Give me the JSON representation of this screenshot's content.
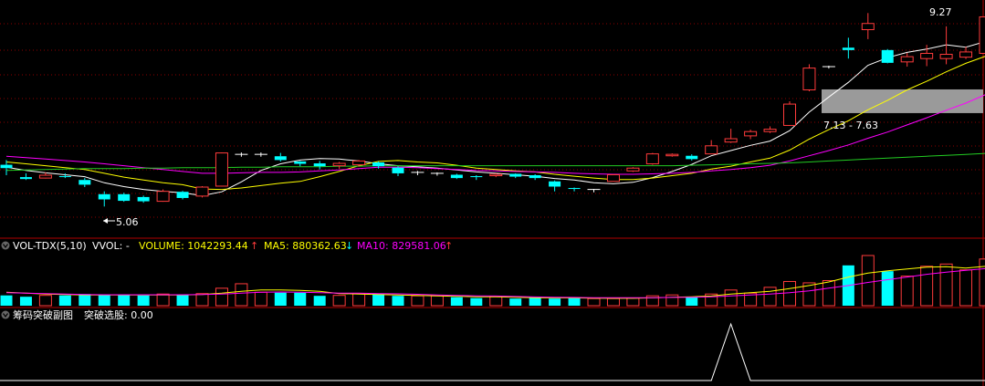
{
  "chart_data": [
    {
      "type": "candlestick",
      "price_labels": {
        "high": "9.27",
        "low": "5.06",
        "range": "7.13 - 7.63"
      },
      "colors": {
        "up": "#ff3b3b",
        "down": "#00ffff",
        "flat": "#ffffff",
        "ma_white": "#ffffff",
        "ma_yellow": "#ffff00",
        "ma_magenta": "#ff00ff",
        "ma_green": "#22cc22",
        "grid": "#8b0000",
        "band": "#9a9a9a"
      },
      "candles": [
        [
          6.04,
          6.14,
          5.82,
          5.97
        ],
        [
          5.78,
          5.86,
          5.72,
          5.74
        ],
        [
          5.76,
          5.88,
          5.75,
          5.82
        ],
        [
          5.8,
          5.86,
          5.76,
          5.79
        ],
        [
          5.72,
          5.76,
          5.57,
          5.62
        ],
        [
          5.42,
          5.48,
          5.16,
          5.31
        ],
        [
          5.42,
          5.45,
          5.26,
          5.28
        ],
        [
          5.36,
          5.39,
          5.24,
          5.27
        ],
        [
          5.27,
          5.52,
          5.26,
          5.48
        ],
        [
          5.47,
          5.49,
          5.31,
          5.34
        ],
        [
          5.38,
          5.59,
          5.35,
          5.57
        ],
        [
          5.59,
          6.3,
          5.58,
          6.29
        ],
        [
          6.26,
          6.3,
          6.21,
          6.26
        ],
        [
          6.26,
          6.3,
          6.21,
          6.26
        ],
        [
          6.22,
          6.29,
          6.11,
          6.14
        ],
        [
          6.11,
          6.12,
          6.01,
          6.06
        ],
        [
          6.07,
          6.12,
          5.94,
          6.01
        ],
        [
          6.02,
          6.1,
          5.95,
          6.07
        ],
        [
          6.04,
          6.14,
          6.0,
          6.12
        ],
        [
          6.09,
          6.11,
          5.96,
          6.01
        ],
        [
          5.98,
          6.01,
          5.8,
          5.86
        ],
        [
          5.88,
          5.91,
          5.82,
          5.88
        ],
        [
          5.86,
          5.88,
          5.81,
          5.86
        ],
        [
          5.83,
          5.85,
          5.74,
          5.76
        ],
        [
          5.8,
          5.82,
          5.72,
          5.78
        ],
        [
          5.81,
          5.86,
          5.78,
          5.84
        ],
        [
          5.85,
          5.86,
          5.76,
          5.79
        ],
        [
          5.82,
          5.84,
          5.72,
          5.76
        ],
        [
          5.69,
          5.71,
          5.48,
          5.58
        ],
        [
          5.55,
          5.56,
          5.48,
          5.54
        ],
        [
          5.52,
          5.53,
          5.46,
          5.52
        ],
        [
          5.69,
          5.84,
          5.69,
          5.83
        ],
        [
          5.91,
          5.99,
          5.89,
          5.97
        ],
        [
          6.06,
          6.29,
          6.04,
          6.27
        ],
        [
          6.23,
          6.28,
          6.21,
          6.26
        ],
        [
          6.23,
          6.26,
          6.13,
          6.16
        ],
        [
          6.27,
          6.56,
          6.27,
          6.44
        ],
        [
          6.52,
          6.8,
          6.5,
          6.59
        ],
        [
          6.65,
          6.78,
          6.58,
          6.74
        ],
        [
          6.74,
          6.85,
          6.71,
          6.79
        ],
        [
          6.87,
          7.38,
          6.86,
          7.32
        ],
        [
          7.62,
          8.16,
          7.59,
          8.08
        ],
        [
          8.11,
          8.13,
          8.07,
          8.11
        ],
        [
          8.51,
          8.72,
          8.28,
          8.46
        ],
        [
          8.89,
          9.24,
          8.69,
          9.02
        ],
        [
          8.46,
          8.48,
          8.18,
          8.19
        ],
        [
          8.21,
          8.4,
          8.11,
          8.32
        ],
        [
          8.28,
          8.57,
          8.12,
          8.39
        ],
        [
          8.28,
          8.96,
          8.16,
          8.37
        ],
        [
          8.31,
          8.53,
          8.27,
          8.42
        ],
        [
          8.39,
          9.27,
          8.34,
          9.16
        ]
      ],
      "moving_averages": {
        "white": [
          5.99,
          5.92,
          5.87,
          5.83,
          5.79,
          5.66,
          5.58,
          5.52,
          5.48,
          5.45,
          5.39,
          5.47,
          5.68,
          5.92,
          6.06,
          6.14,
          6.17,
          6.16,
          6.12,
          6.06,
          6.02,
          6.0,
          5.97,
          5.93,
          5.89,
          5.86,
          5.83,
          5.8,
          5.75,
          5.72,
          5.66,
          5.64,
          5.67,
          5.77,
          5.9,
          6.05,
          6.23,
          6.34,
          6.45,
          6.54,
          6.76,
          7.15,
          7.47,
          7.78,
          8.14,
          8.3,
          8.41,
          8.48,
          8.57,
          8.52,
          8.64
        ],
        "yellow": [
          6.1,
          6.06,
          6.02,
          5.98,
          5.94,
          5.86,
          5.78,
          5.72,
          5.66,
          5.62,
          5.53,
          5.52,
          5.55,
          5.6,
          5.65,
          5.69,
          5.79,
          5.9,
          6.02,
          6.11,
          6.13,
          6.1,
          6.08,
          6.03,
          5.97,
          5.94,
          5.91,
          5.89,
          5.84,
          5.8,
          5.76,
          5.73,
          5.73,
          5.76,
          5.81,
          5.86,
          5.95,
          6.01,
          6.1,
          6.18,
          6.35,
          6.58,
          6.78,
          6.97,
          7.2,
          7.4,
          7.62,
          7.8,
          8.0,
          8.18,
          8.33
        ],
        "magenta": [
          6.22,
          6.19,
          6.16,
          6.13,
          6.1,
          6.06,
          6.02,
          5.98,
          5.94,
          5.9,
          5.86,
          5.86,
          5.87,
          5.88,
          5.88,
          5.89,
          5.91,
          5.93,
          5.96,
          5.99,
          5.99,
          5.98,
          5.96,
          5.94,
          5.92,
          5.91,
          5.9,
          5.89,
          5.88,
          5.86,
          5.85,
          5.84,
          5.84,
          5.85,
          5.86,
          5.88,
          5.91,
          5.94,
          5.98,
          6.03,
          6.12,
          6.23,
          6.34,
          6.46,
          6.6,
          6.73,
          6.88,
          7.03,
          7.19,
          7.34,
          7.52
        ],
        "green": [
          5.92,
          5.93,
          5.94,
          5.95,
          5.96,
          5.96,
          5.96,
          5.97,
          5.97,
          5.98,
          5.98,
          5.98,
          5.99,
          5.99,
          6.0,
          6.0,
          6.0,
          6.01,
          6.01,
          6.02,
          6.02,
          6.02,
          6.02,
          6.02,
          6.02,
          6.02,
          6.02,
          6.02,
          6.02,
          6.02,
          6.02,
          6.02,
          6.02,
          6.02,
          6.02,
          6.03,
          6.04,
          6.05,
          6.06,
          6.07,
          6.08,
          6.1,
          6.12,
          6.14,
          6.16,
          6.18,
          6.2,
          6.22,
          6.24,
          6.26,
          6.28
        ]
      },
      "band": [
        7.13,
        7.63
      ]
    },
    {
      "type": "bar",
      "indicator": "VOL-TDX(5,10)",
      "labels": {
        "name": "VOL-TDX(5,10)",
        "vol": "VVOL: -",
        "volume": "VOLUME: 1042293.44",
        "ma5": "MA5: 880362.63",
        "ma10": "MA10: 829581.06"
      },
      "colors": {
        "label": "#ffffff",
        "volume": "#ffff00",
        "ma5": "#ffff00",
        "ma10": "#ff00ff",
        "up_arrow": "#ff3b3b",
        "down_arrow": "#00ffff"
      },
      "arrows": [
        "↑",
        "↑",
        "↓",
        "↑"
      ],
      "volumes": [
        230000,
        200000,
        230000,
        230000,
        260000,
        240000,
        240000,
        230000,
        260000,
        240000,
        270000,
        390000,
        490000,
        300000,
        290000,
        290000,
        220000,
        230000,
        270000,
        260000,
        220000,
        220000,
        220000,
        190000,
        170000,
        200000,
        160000,
        180000,
        160000,
        170000,
        160000,
        160000,
        170000,
        220000,
        240000,
        190000,
        260000,
        350000,
        280000,
        410000,
        540000,
        510000,
        560000,
        900000,
        1120000,
        770000,
        660000,
        880000,
        930000,
        800000,
        1042293
      ],
      "ma5_values": [
        300000,
        280000,
        260000,
        250000,
        240000,
        240000,
        240000,
        240000,
        240000,
        240000,
        250000,
        280000,
        320000,
        350000,
        350000,
        340000,
        320000,
        270000,
        260000,
        250000,
        240000,
        230000,
        220000,
        210000,
        200000,
        200000,
        190000,
        180000,
        175000,
        175000,
        170000,
        165000,
        165000,
        175000,
        190000,
        200000,
        215000,
        260000,
        290000,
        320000,
        380000,
        450000,
        530000,
        640000,
        730000,
        780000,
        820000,
        860000,
        870000,
        840000,
        880363
      ],
      "ma10_values": [
        290000,
        280000,
        270000,
        260000,
        250000,
        245000,
        245000,
        245000,
        245000,
        245000,
        250000,
        260000,
        280000,
        300000,
        305000,
        300000,
        290000,
        280000,
        280000,
        270000,
        265000,
        255000,
        240000,
        230000,
        220000,
        215000,
        205000,
        195000,
        190000,
        185000,
        180000,
        178000,
        177000,
        180000,
        185000,
        190000,
        200000,
        220000,
        240000,
        260000,
        290000,
        330000,
        390000,
        450000,
        520000,
        580000,
        640000,
        700000,
        750000,
        790000,
        829581
      ]
    },
    {
      "type": "line",
      "indicator": "筹码突破副图",
      "labels": {
        "name": "筹码突破副图",
        "breakout": "突破选股: 0.00"
      },
      "colors": {
        "label": "#ffffff",
        "line": "#ffffff"
      },
      "values": [
        0,
        0,
        0,
        0,
        0,
        0,
        0,
        0,
        0,
        0,
        0,
        0,
        0,
        0,
        0,
        0,
        0,
        0,
        0,
        0,
        0,
        0,
        0,
        0,
        0,
        0,
        0,
        0,
        0,
        0,
        0,
        0,
        0,
        0,
        0,
        0,
        0,
        1,
        0,
        0,
        0,
        0,
        0,
        0,
        0,
        0,
        0,
        0,
        0,
        0,
        0
      ]
    }
  ]
}
